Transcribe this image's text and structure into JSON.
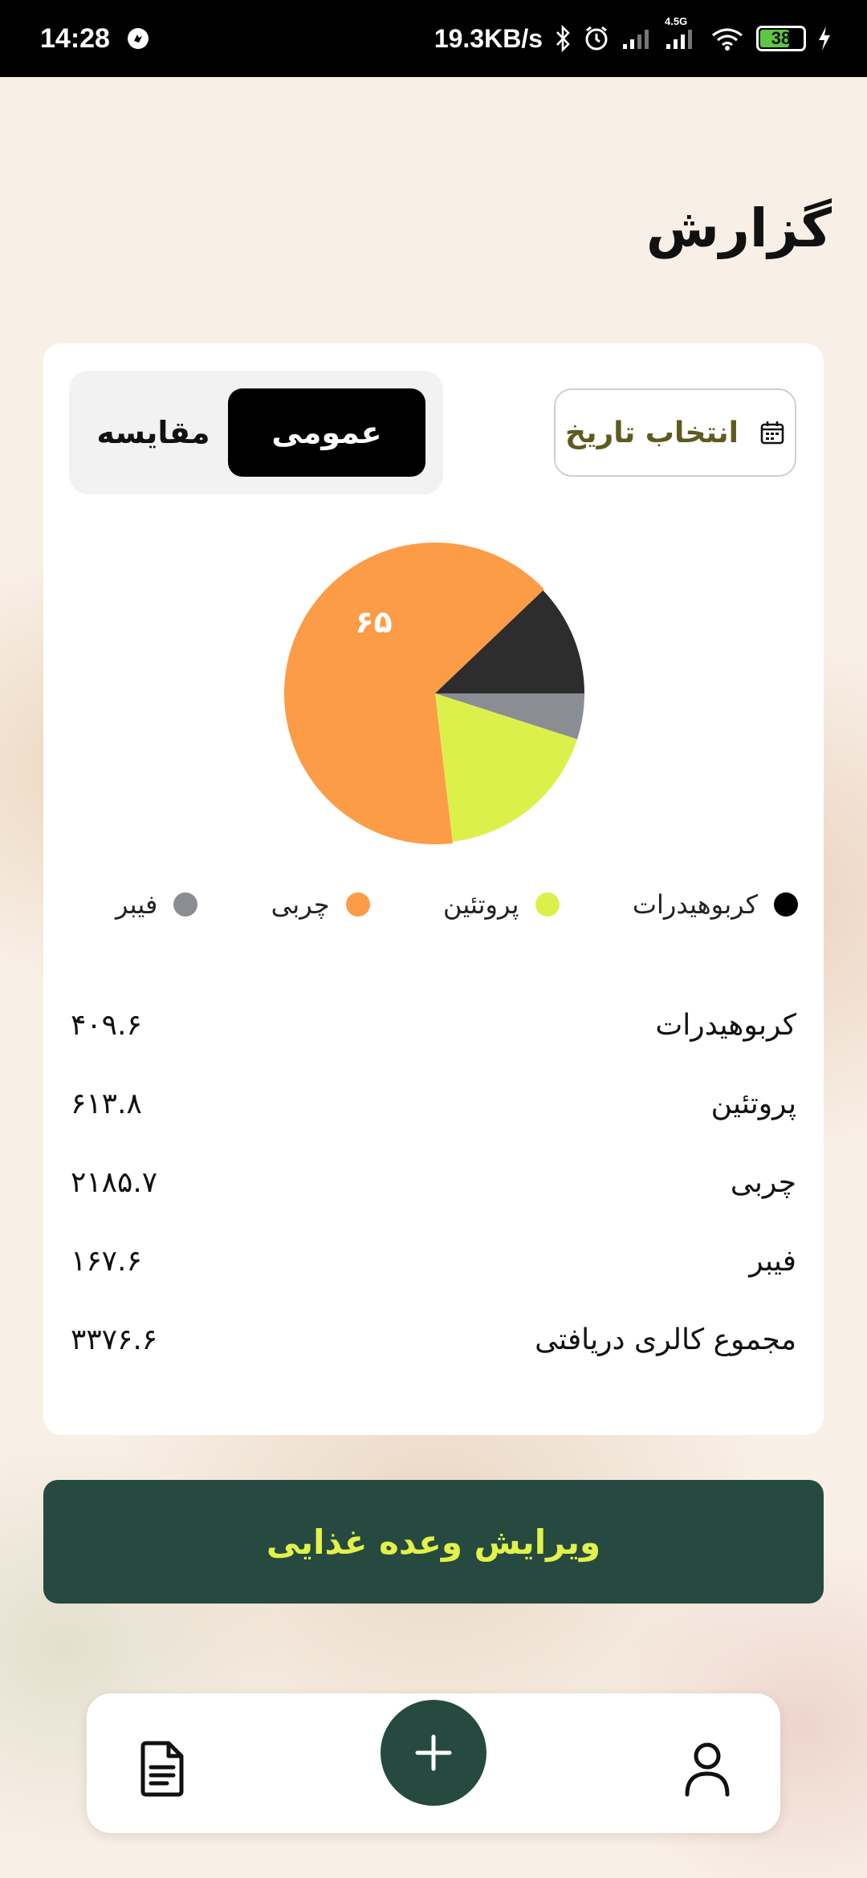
{
  "status_bar": {
    "time": "14:28",
    "speed": "19.3KB/s",
    "network_type": "4.5G",
    "battery": "38",
    "icons": [
      "app-notification-icon",
      "bluetooth-icon",
      "alarm-icon",
      "signal-icon",
      "signal-4g-icon",
      "wifi-icon",
      "battery-icon",
      "charging-icon"
    ]
  },
  "header": {
    "title": "گزارش"
  },
  "filters": {
    "date_button_label": "انتخاب تاریخ",
    "date_icon": "calendar-icon",
    "tabs": [
      {
        "label": "عمومی",
        "active": true
      },
      {
        "label": "مقایسه",
        "active": false
      }
    ]
  },
  "chart_data": {
    "type": "pie",
    "title": "",
    "slices": [
      {
        "label": "کربوهیدرات",
        "value": 409.6,
        "color": "#2d2d2d"
      },
      {
        "label": "پروتئین",
        "value": 613.8,
        "color": "#dcf04b"
      },
      {
        "label": "چربی",
        "value": 2185.7,
        "color": "#fd9c46"
      },
      {
        "label": "فیبر",
        "value": 167.6,
        "color": "#8a8e93"
      }
    ],
    "data_labels": [
      {
        "slice": "چربی",
        "text": "۶۵"
      }
    ]
  },
  "legend": [
    {
      "label": "کربوهیدرات",
      "color": "#000000"
    },
    {
      "label": "پروتئین",
      "color": "#dcf04b"
    },
    {
      "label": "چربی",
      "color": "#fd9c46"
    },
    {
      "label": "فیبر",
      "color": "#8a8e93"
    }
  ],
  "stats": [
    {
      "label": "کربوهیدرات",
      "value": "۴۰۹.۶"
    },
    {
      "label": "پروتئین",
      "value": "۶۱۳.۸"
    },
    {
      "label": "چربی",
      "value": "۲۱۸۵.۷"
    },
    {
      "label": "فیبر",
      "value": "۱۶۷.۶"
    },
    {
      "label": "مجموع کالری دریافتی",
      "value": "۳۳۷۶.۶"
    }
  ],
  "actions": {
    "edit_meal_label": "ویرایش وعده غذایی"
  },
  "bottom_nav": {
    "left_icon": "report-document-icon",
    "center_icon": "plus-icon",
    "right_icon": "profile-icon"
  }
}
